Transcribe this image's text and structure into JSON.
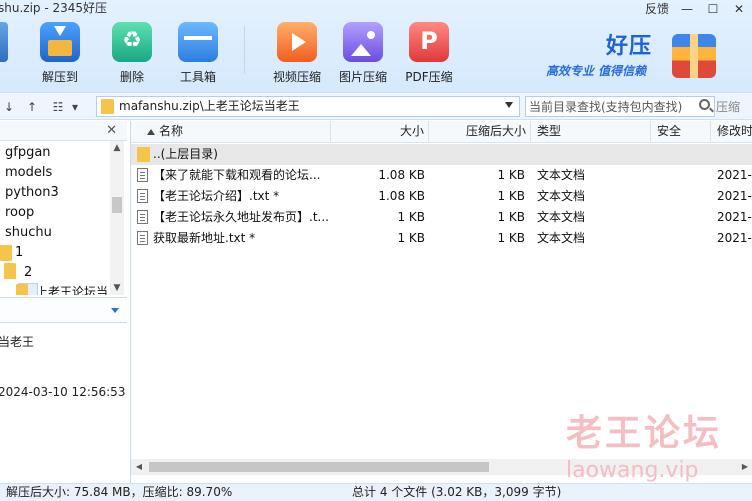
{
  "window": {
    "title": "shu.zip - 2345好压",
    "feedback": "反馈",
    "minimize": "—",
    "maximize": "☐",
    "close": "✕"
  },
  "toolbar": {
    "extract": "解压到",
    "delete": "删除",
    "toolbox": "工具箱",
    "video": "视频压缩",
    "image": "图片压缩",
    "pdf": "PDF压缩"
  },
  "brand": {
    "name": "好压",
    "slogan": "高效专业 值得信赖"
  },
  "nav": {
    "back": "↓",
    "up": "↑",
    "view": "☷",
    "view_dd": "▾"
  },
  "address": {
    "path": "mafanshu.zip\\上老王论坛当老王"
  },
  "search": {
    "placeholder": "当前目录查找(支持包内查找)",
    "button": "压缩"
  },
  "tree": {
    "items": [
      "gfpgan",
      "models",
      "python3",
      "roop",
      "shuchu",
      "1",
      "2",
      "上老王论坛当"
    ]
  },
  "info": {
    "name": "当老王",
    "date": "2024-03-10 12:56:53"
  },
  "columns": {
    "name": "名称",
    "size": "大小",
    "csize": "压缩后大小",
    "type": "类型",
    "security": "安全",
    "modified": "修改时"
  },
  "parent_row": "..(上层目录)",
  "files": [
    {
      "name": "【来了就能下载和观看的论坛...",
      "size": "1.08 KB",
      "csize": "1 KB",
      "type": "文本文档",
      "modified": "2021-"
    },
    {
      "name": "【老王论坛介绍】.txt *",
      "size": "1.08 KB",
      "csize": "1 KB",
      "type": "文本文档",
      "modified": "2021-"
    },
    {
      "name": "【老王论坛永久地址发布页】.t...",
      "size": "1 KB",
      "csize": "1 KB",
      "type": "文本文档",
      "modified": "2021-"
    },
    {
      "name": "获取最新地址.txt *",
      "size": "1 KB",
      "csize": "1 KB",
      "type": "文本文档",
      "modified": "2021-"
    }
  ],
  "watermark": {
    "cn": "老王论坛",
    "url": "laowang.vip"
  },
  "status": {
    "left": "解压后大小: 75.84 MB，压缩比: 89.70%",
    "right": "总计 4 个文件 (3.02 KB，3,099 字节)"
  }
}
